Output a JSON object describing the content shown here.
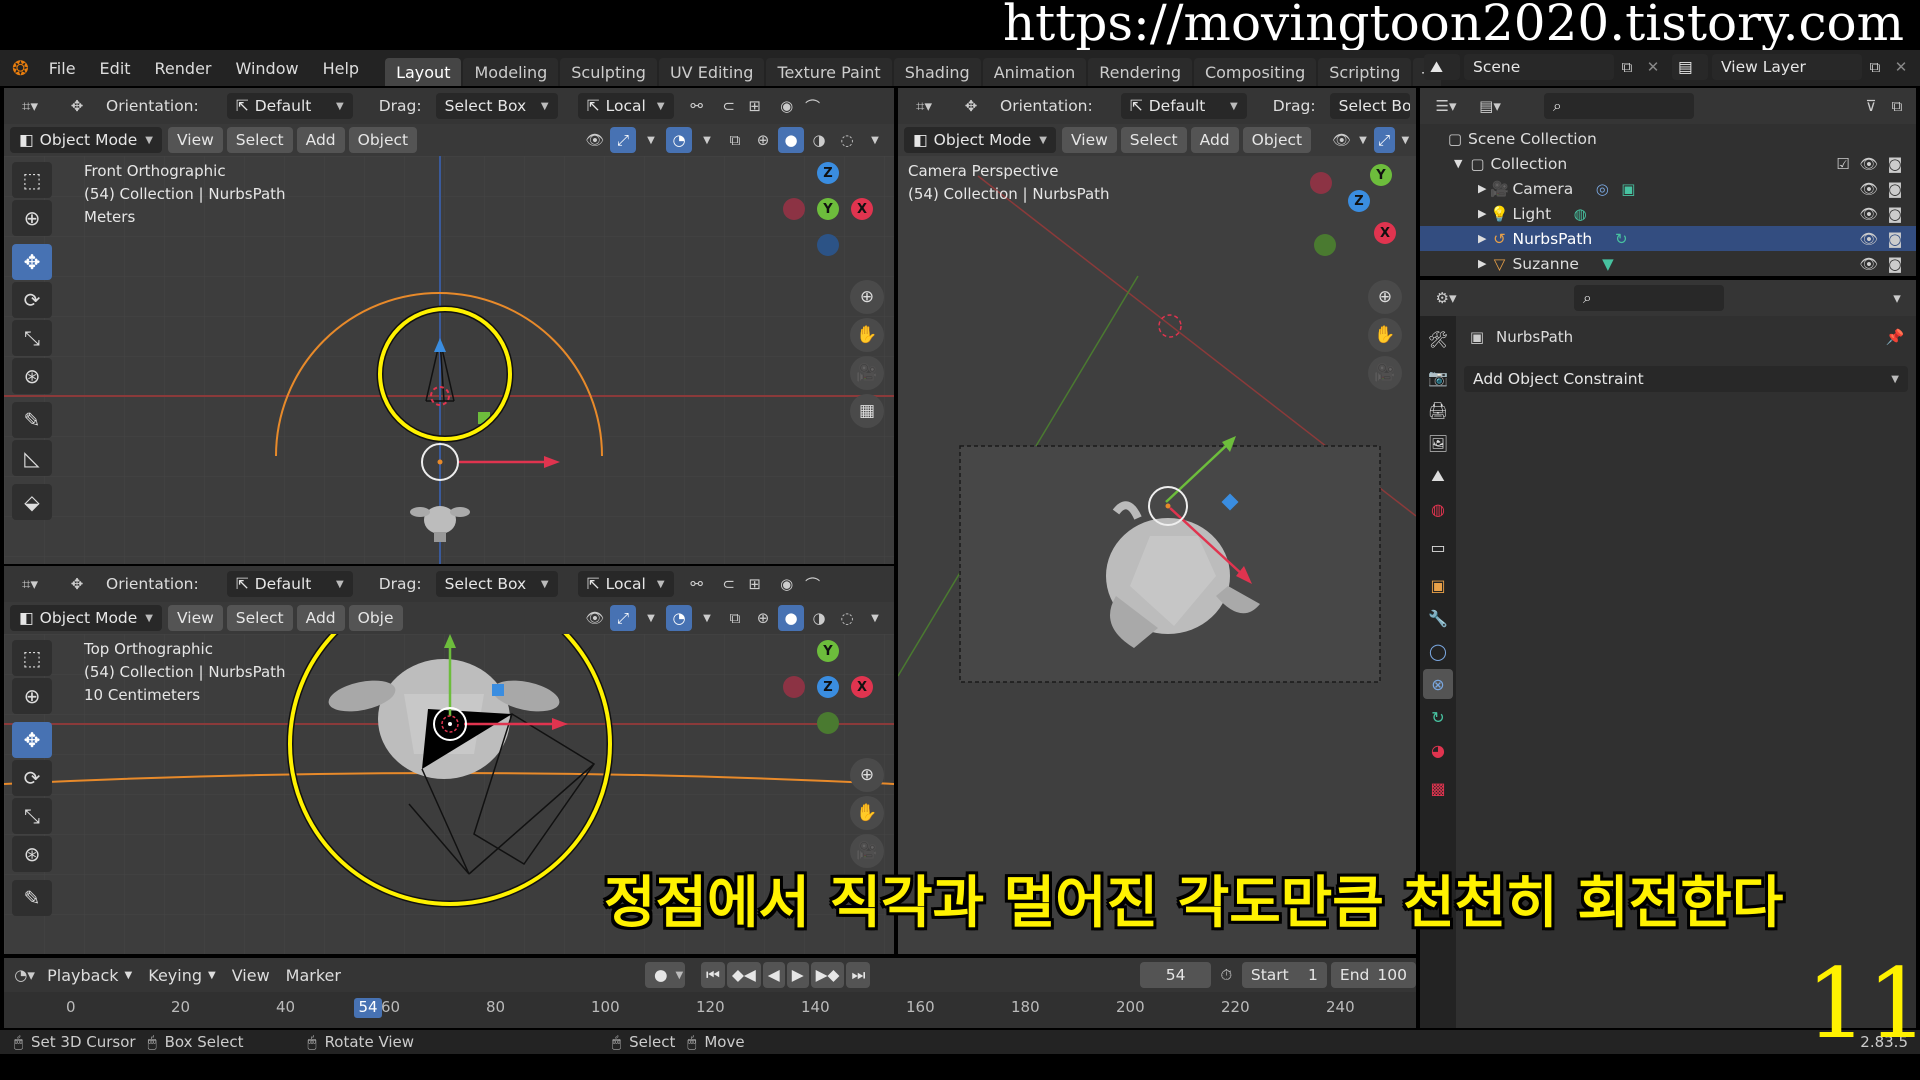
{
  "watermark": "https://movingtoon2020.tistory.com",
  "menu": [
    "File",
    "Edit",
    "Render",
    "Window",
    "Help"
  ],
  "workspaces": [
    "Layout",
    "Modeling",
    "Sculpting",
    "UV Editing",
    "Texture Paint",
    "Shading",
    "Animation",
    "Rendering",
    "Compositing",
    "Scripting"
  ],
  "active_workspace": "Layout",
  "scene": "Scene",
  "view_layer": "View Layer",
  "header": {
    "orientation_label": "Orientation:",
    "orientation_value": "Default",
    "drag_label": "Drag:",
    "drag_value": "Select Box",
    "pivot_value": "Local",
    "mode": "Object Mode",
    "view": "View",
    "select": "Select",
    "add": "Add",
    "object": "Object",
    "object_truncated": "Obje"
  },
  "viewports": {
    "front": {
      "line1": "Front Orthographic",
      "line2": "(54) Collection | NurbsPath",
      "line3": "Meters"
    },
    "top": {
      "line1": "Top Orthographic",
      "line2": "(54) Collection | NurbsPath",
      "line3": "10 Centimeters"
    },
    "camera": {
      "line1": "Camera Perspective",
      "line2": "(54) Collection | NurbsPath"
    }
  },
  "axes": {
    "x": "X",
    "y": "Y",
    "z": "Z"
  },
  "outliner": {
    "root": "Scene Collection",
    "collection": "Collection",
    "items": [
      {
        "name": "Camera",
        "color": "#e8a048",
        "selected": false
      },
      {
        "name": "Light",
        "color": "#e8a048",
        "selected": false
      },
      {
        "name": "NurbsPath",
        "color": "#e8a048",
        "selected": true
      },
      {
        "name": "Suzanne",
        "color": "#e8a048",
        "selected": false
      }
    ]
  },
  "properties": {
    "object_name": "NurbsPath",
    "add_constraint": "Add Object Constraint"
  },
  "timeline": {
    "playback": "Playback",
    "keying": "Keying",
    "view": "View",
    "marker": "Marker",
    "current_frame": "54",
    "start_label": "Start",
    "start_value": "1",
    "end_label": "End",
    "end_value": "100",
    "ticks": [
      "0",
      "20",
      "40",
      "60",
      "80",
      "100",
      "120",
      "140",
      "160",
      "180",
      "200",
      "220",
      "240"
    ],
    "playhead_label": "54"
  },
  "statusbar": {
    "set_cursor": "Set 3D Cursor",
    "box_select": "Box Select",
    "rotate_view": "Rotate View",
    "select": "Select",
    "move": "Move",
    "version": "2.83.5"
  },
  "subtitle": "정점에서 직각과 멀어진 각도만큼 천천히 회전한다",
  "lesson_number": "11",
  "colors": {
    "accent": "#4772b3",
    "highlight": "#fff200",
    "axis_x": "#e0344f",
    "axis_y": "#6dbd3c",
    "axis_z": "#3a8de0",
    "path": "#e88a2a"
  }
}
